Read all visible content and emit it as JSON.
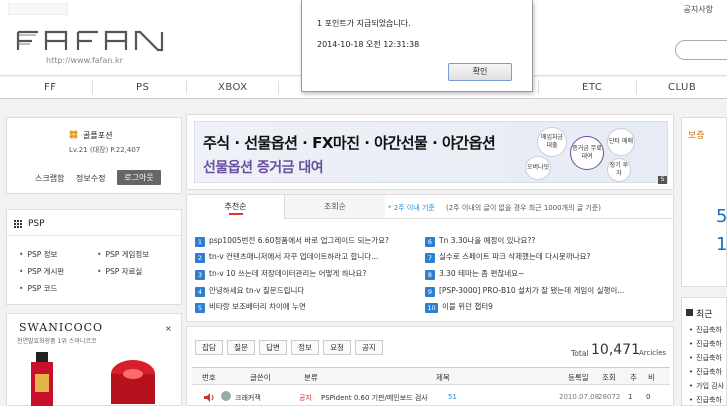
{
  "header": {
    "notice_link": "공지사항",
    "site_url": "http://www.fafan.kr",
    "logo_alt": "FAFAN"
  },
  "nav": {
    "items": [
      "FF",
      "PS",
      "XBOX",
      "ETC",
      "CLUB"
    ]
  },
  "dialog": {
    "message": "1 포인트가 지급되었습니다.",
    "timestamp": "2014-10-18 오전 12:31:38",
    "ok_label": "확인"
  },
  "user": {
    "name": "골플포션",
    "level": "Lv.21 (대장) P.22,407",
    "scrap_label": "스크랩함",
    "edit_label": "정보수정",
    "logout_label": "로그아웃"
  },
  "psp_menu": {
    "title": "PSP",
    "links": [
      "PSP 정보",
      "PSP 게임정보",
      "PSP 게시판",
      "PSP 자료실",
      "PSP 코드"
    ]
  },
  "ad": {
    "brand": "SWANICOCO",
    "subtitle": "천연발효화장품 1위 스와니코코",
    "close": "×"
  },
  "banner": {
    "line1": "주식 · 선물옵션 · FX마진 · 야간선물 · 야간옵션",
    "line2": "선물옵션 증거금 대여",
    "bubbles": [
      "매입자금 대출",
      "증거금 무료대여",
      "단타 매매",
      "오버나잇",
      "장기 투자"
    ],
    "badge": "S"
  },
  "board": {
    "tab_recommend": "추천순",
    "tab_views": "조회순",
    "note_highlight": "* 2주 이내 기준",
    "note_rest": "(2주 이내의 글이 없을 경우 최근 1000개의 글 기준)",
    "posts_left": [
      {
        "n": "1",
        "title": "psp1005번전 6.60정품에서 바로 업그레이드 되는가요?"
      },
      {
        "n": "2",
        "title": "tn-v 컨텐츠매니저에서 자꾸 업데이트하라고 합니다..."
      },
      {
        "n": "3",
        "title": "tn-v 10 쓰는데 저장데이터관리는 어떻게 하나요?"
      },
      {
        "n": "4",
        "title": "안녕하세요 tn-v 질문드립니다"
      },
      {
        "n": "5",
        "title": "비타랑 보조배터리 차이에 누면"
      }
    ],
    "posts_right": [
      {
        "n": "6",
        "title": "Tn 3.30나올 예정이 있나요??"
      },
      {
        "n": "7",
        "title": "실수로 스페이트 파크 삭제했는데 다시못까나요?"
      },
      {
        "n": "8",
        "title": "3.30 테마는 좀 편찮네요~"
      },
      {
        "n": "9",
        "title": "[PSP-3000] PRO-B10 설치가 잘 됐는데 게임이 실행이..."
      },
      {
        "n": "10",
        "title": "이블 위던 챕터9"
      }
    ]
  },
  "list": {
    "categories": [
      "잡담",
      "질문",
      "답변",
      "정보",
      "요청",
      "공지"
    ],
    "total_label": "Total",
    "total_count": "10,471",
    "total_unit": "Arcicles",
    "headers": [
      "번호",
      "글쓴이",
      "분류",
      "제목",
      "등록일",
      "조회",
      "추",
      "비"
    ],
    "row": {
      "author": "크래커잭",
      "category": "공지",
      "title": "PSPident 0.60 기판/메인보드 검사",
      "comments": "51",
      "date": "2010.07.08",
      "views": "28072",
      "up": "1",
      "down": "0"
    }
  },
  "right": {
    "top_label": "보증",
    "top_digit": "5",
    "top_digit2": "1",
    "section_title": "최근",
    "links": [
      "진급축하",
      "진급축하",
      "진급축하",
      "진급축하",
      "가입 감사",
      "진급축하"
    ]
  },
  "colors": {
    "accent_blue": "#2f7fd0",
    "note_blue": "#1a8fd6",
    "banner_purple": "#6a4fa0"
  }
}
